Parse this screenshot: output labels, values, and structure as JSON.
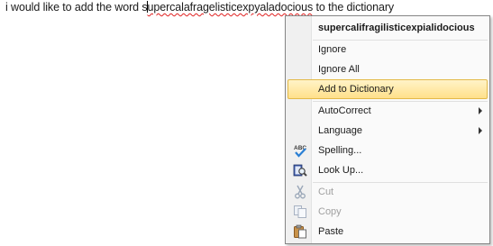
{
  "document": {
    "text_before": "i would like to add the word s",
    "text_misspelled": "upercalafragelisticexpyaladocious",
    "text_after": " to the dictionary"
  },
  "context_menu": {
    "suggestion": "supercalifragilisticexpialidocious",
    "items": {
      "ignore": "Ignore",
      "ignore_all": "Ignore All",
      "add_to_dictionary": "Add to Dictionary",
      "autocorrect": "AutoCorrect",
      "language": "Language",
      "spelling": "Spelling...",
      "look_up": "Look Up...",
      "cut": "Cut",
      "copy": "Copy",
      "paste": "Paste"
    },
    "icons": {
      "spelling": "spelling-abc-check-icon",
      "look_up": "research-book-magnifier-icon",
      "cut": "scissors-icon",
      "copy": "copy-icon",
      "paste": "paste-clipboard-icon",
      "submenu": "submenu-arrow-icon"
    },
    "colors": {
      "hover_top": "#fff3c8",
      "hover_bottom": "#ffe08a",
      "hover_border": "#e3b948",
      "misspelling_underline": "#e02020"
    }
  }
}
